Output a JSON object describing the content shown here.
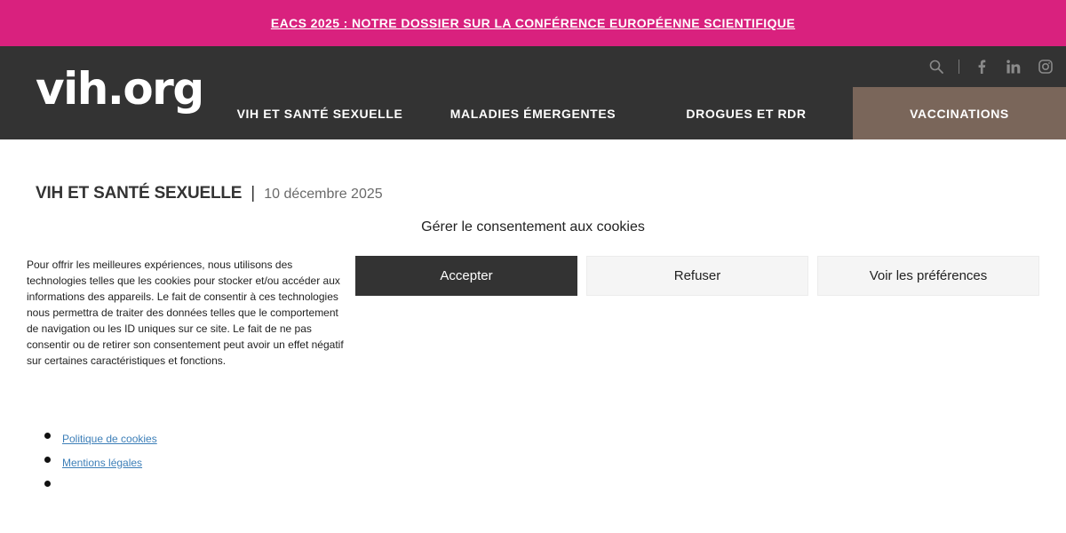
{
  "announcement": {
    "text": "EACS 2025 : NOTRE DOSSIER SUR LA CONFÉRENCE EUROPÉENNE SCIENTIFIQUE"
  },
  "header": {
    "logo": "vih.org",
    "icons": [
      "search-icon",
      "facebook-icon",
      "linkedin-icon",
      "instagram-icon"
    ],
    "nav": [
      {
        "label": "VIH ET SANTÉ SEXUELLE"
      },
      {
        "label": "MALADIES ÉMERGENTES"
      },
      {
        "label": "DROGUES ET RDR"
      },
      {
        "label": "VACCINATIONS",
        "active": true
      }
    ]
  },
  "article": {
    "category": "VIH ET SANTÉ SEXUELLE",
    "separator": "|",
    "date": "10 décembre 2025"
  },
  "cookie": {
    "title": "Gérer le consentement aux cookies",
    "text": "Pour offrir les meilleures expériences, nous utilisons des technologies telles que les cookies pour stocker et/ou accéder aux informations des appareils. Le fait de consentir à ces technologies nous permettra de traiter des données telles que le comportement de navigation ou les ID uniques sur ce site. Le fait de ne pas consentir ou de retirer son consentement peut avoir un effet négatif sur certaines caractéristiques et fonctions.",
    "accept": "Accepter",
    "refuse": "Refuser",
    "preferences": "Voir les préférences",
    "links": [
      "Politique de cookies",
      "Mentions légales",
      ""
    ]
  },
  "colors": {
    "announcement_bg": "#d9217e",
    "header_bg": "#333333",
    "active_nav_bg": "#7a665a",
    "link": "#3d7fb8"
  }
}
